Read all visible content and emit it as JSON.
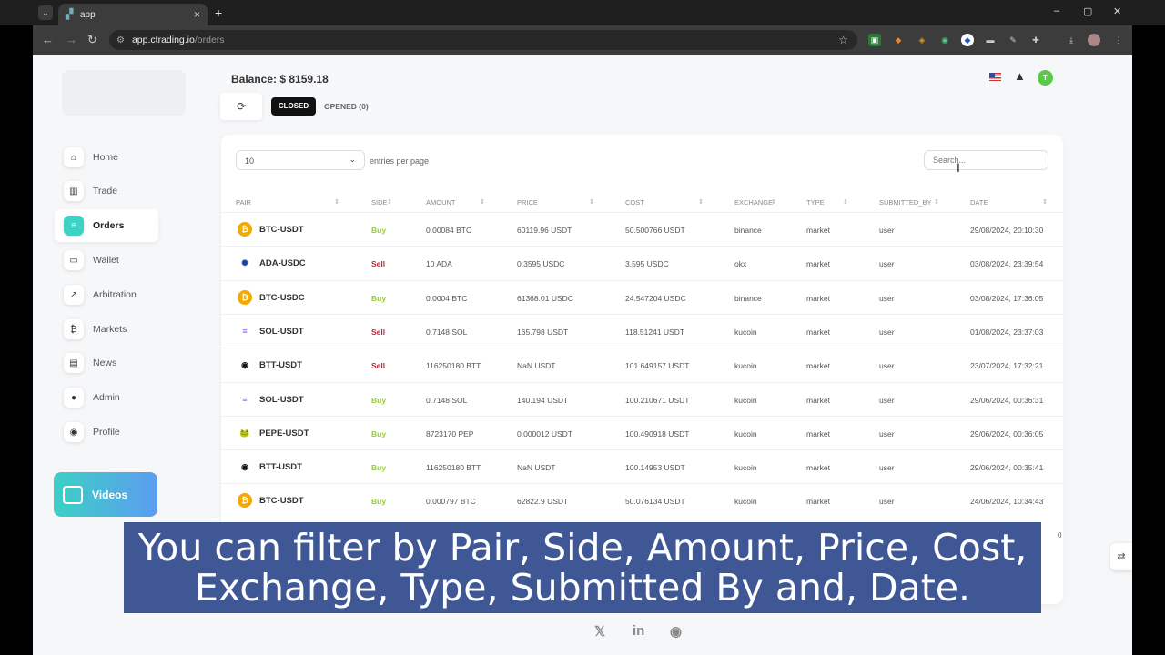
{
  "browser": {
    "tab_title": "app",
    "tab_close": "×",
    "new_tab": "+",
    "tab_list_icon": "⌄",
    "url_domain": "app.ctrading.io",
    "url_path": "/orders",
    "window_controls": [
      "–",
      "▢",
      "✕"
    ]
  },
  "sidebar": {
    "items": [
      {
        "label": "Home",
        "icon": "home-icon",
        "glyph": "⌂"
      },
      {
        "label": "Trade",
        "icon": "chart-icon",
        "glyph": "▥"
      },
      {
        "label": "Orders",
        "icon": "document-icon",
        "glyph": "≡"
      },
      {
        "label": "Wallet",
        "icon": "wallet-icon",
        "glyph": "▭"
      },
      {
        "label": "Arbitration",
        "icon": "trend-icon",
        "glyph": "↗"
      },
      {
        "label": "Markets",
        "icon": "bitcoin-icon",
        "glyph": "₿"
      },
      {
        "label": "News",
        "icon": "newspaper-icon",
        "glyph": "▤"
      },
      {
        "label": "Admin",
        "icon": "admin-icon",
        "glyph": "●"
      },
      {
        "label": "Profile",
        "icon": "user-icon",
        "glyph": "◉"
      }
    ],
    "active": "Orders",
    "videos_label": "Videos"
  },
  "header": {
    "balance_label": "Balance:",
    "balance_value": "$ 8159.18",
    "refresh_glyph": "⟳",
    "closed_label": "CLOSED",
    "opened_label": "OPENED (0)",
    "avatar_letter": "T",
    "bell_glyph": "🔔"
  },
  "table": {
    "page_size": "10",
    "entries_label": "entries per page",
    "search_placeholder": "Search...",
    "columns": [
      "PAIR",
      "SIDE",
      "AMOUNT",
      "PRICE",
      "COST",
      "EXCHANGE",
      "TYPE",
      "SUBMITTED_BY",
      "DATE"
    ],
    "rows": [
      {
        "coin": "btc",
        "pair": "BTC-USDT",
        "side": "Buy",
        "amount": "0.00084 BTC",
        "price": "60119.96 USDT",
        "cost": "50.500766 USDT",
        "exchange": "binance",
        "type": "market",
        "by": "user",
        "date": "29/08/2024, 20:10:30"
      },
      {
        "coin": "ada",
        "pair": "ADA-USDC",
        "side": "Sell",
        "amount": "10 ADA",
        "price": "0.3595 USDC",
        "cost": "3.595 USDC",
        "exchange": "okx",
        "type": "market",
        "by": "user",
        "date": "03/08/2024, 23:39:54"
      },
      {
        "coin": "btc",
        "pair": "BTC-USDC",
        "side": "Buy",
        "amount": "0.0004 BTC",
        "price": "61368.01 USDC",
        "cost": "24.547204 USDC",
        "exchange": "binance",
        "type": "market",
        "by": "user",
        "date": "03/08/2024, 17:36:05"
      },
      {
        "coin": "sol",
        "pair": "SOL-USDT",
        "side": "Sell",
        "amount": "0.7148 SOL",
        "price": "165.798 USDT",
        "cost": "118.51241 USDT",
        "exchange": "kucoin",
        "type": "market",
        "by": "user",
        "date": "01/08/2024, 23:37:03"
      },
      {
        "coin": "btt",
        "pair": "BTT-USDT",
        "side": "Sell",
        "amount": "116250180 BTT",
        "price": "NaN USDT",
        "cost": "101.649157 USDT",
        "exchange": "kucoin",
        "type": "market",
        "by": "user",
        "date": "23/07/2024, 17:32:21"
      },
      {
        "coin": "sol",
        "pair": "SOL-USDT",
        "side": "Buy",
        "amount": "0.7148 SOL",
        "price": "140.194 USDT",
        "cost": "100.210671 USDT",
        "exchange": "kucoin",
        "type": "market",
        "by": "user",
        "date": "29/06/2024, 00:36:31"
      },
      {
        "coin": "pepe",
        "pair": "PEPE-USDT",
        "side": "Buy",
        "amount": "8723170 PEP",
        "price": "0.000012 USDT",
        "cost": "100.490918 USDT",
        "exchange": "kucoin",
        "type": "market",
        "by": "user",
        "date": "29/06/2024, 00:36:05"
      },
      {
        "coin": "btt",
        "pair": "BTT-USDT",
        "side": "Buy",
        "amount": "116250180 BTT",
        "price": "NaN USDT",
        "cost": "100.14953 USDT",
        "exchange": "kucoin",
        "type": "market",
        "by": "user",
        "date": "29/06/2024, 00:35:41"
      },
      {
        "coin": "btc",
        "pair": "BTC-USDT",
        "side": "Buy",
        "amount": "0.000797 BTC",
        "price": "62822.9 USDT",
        "cost": "50.076134 USDT",
        "exchange": "kucoin",
        "type": "market",
        "by": "user",
        "date": "24/06/2024, 10:34:43"
      }
    ],
    "hidden_row_tail": "0"
  },
  "subtitle": {
    "line1": "You can filter by Pair, Side, Amount, Price, Cost,",
    "line2": "Exchange, Type, Submitted By and, Date."
  },
  "footer": {
    "x_glyph": "𝕏",
    "linkedin_glyph": "in",
    "discord_glyph": "◉"
  },
  "colors": {
    "accent": "#3dd3c4",
    "buy": "#99c93c",
    "sell": "#c0263f",
    "subtitle_bg": "#3f5895"
  }
}
